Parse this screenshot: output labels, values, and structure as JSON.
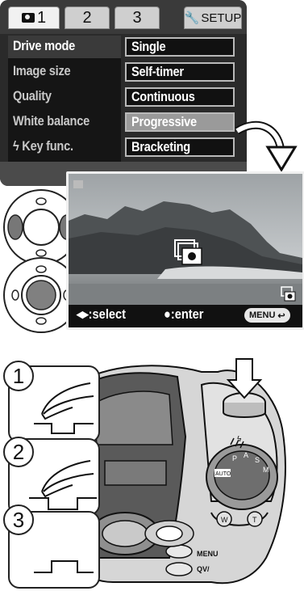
{
  "menu": {
    "tabs": [
      {
        "label": "1",
        "icon": "camera-icon"
      },
      {
        "label": "2"
      },
      {
        "label": "3"
      }
    ],
    "setup_label": "SETUP",
    "items": [
      {
        "label": "Drive mode"
      },
      {
        "label": "Image size"
      },
      {
        "label": "Quality"
      },
      {
        "label": "White balance"
      },
      {
        "label": "Key func.",
        "icon": "flash-icon"
      }
    ],
    "options": [
      "Single",
      "Self-timer",
      "Continuous",
      "Progressive",
      "Bracketing"
    ],
    "highlighted_option": "Progressive"
  },
  "preview": {
    "select_text": ":select",
    "enter_text": ":enter",
    "menu_button": "MENU"
  },
  "steps": [
    "1",
    "2",
    "3"
  ],
  "dial": {
    "labels": [
      "P",
      "A",
      "S",
      "M",
      "AUTO"
    ],
    "buttons": [
      "MENU",
      "QV/\u0000"
    ]
  },
  "colors": {
    "menu_bg": "#2a2a2a",
    "option_highlight": "#9a9a9a",
    "preview_bg": "#111111"
  }
}
